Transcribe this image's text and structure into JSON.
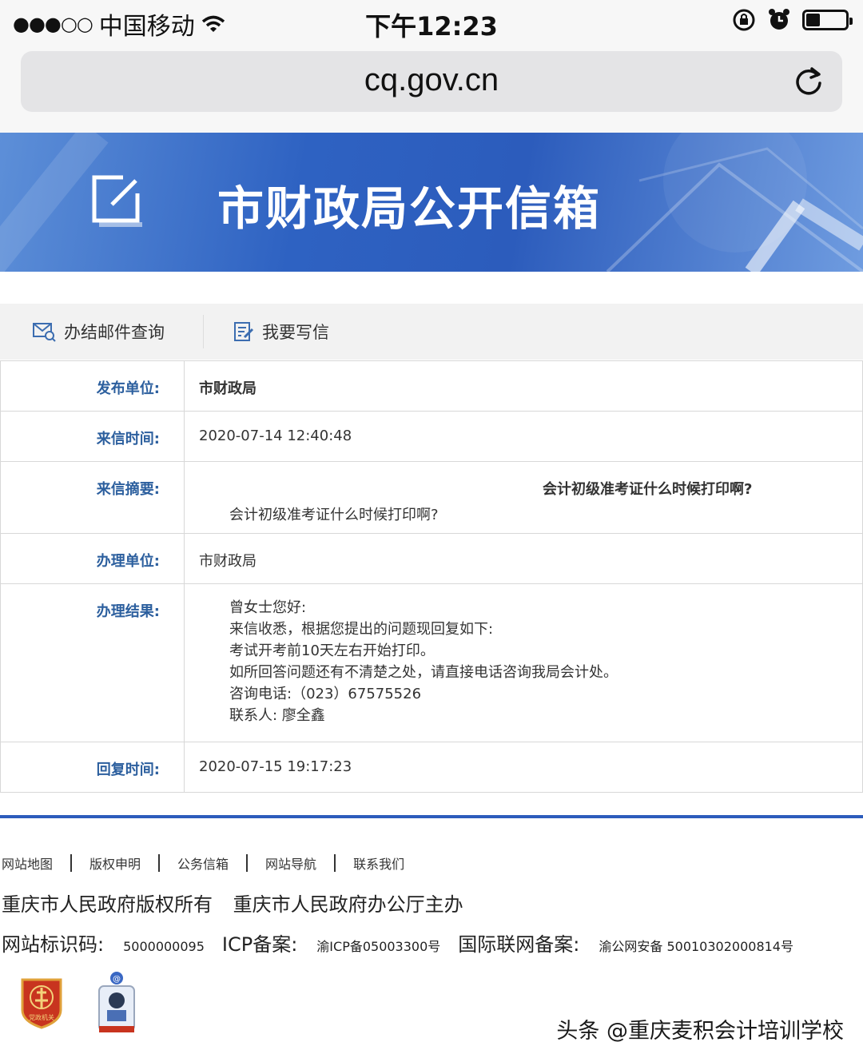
{
  "status_bar": {
    "signal": "●●●○○",
    "carrier": "中国移动",
    "time": "下午12:23",
    "battery_level": 0.35
  },
  "url_bar": {
    "url": "cq.gov.cn"
  },
  "banner": {
    "title": "市财政局公开信箱"
  },
  "tabs": [
    {
      "label": "办结邮件查询",
      "icon": "mail-search-icon"
    },
    {
      "label": "我要写信",
      "icon": "write-letter-icon"
    }
  ],
  "details": {
    "publisher_label": "发布单位:",
    "publisher_value": "市财政局",
    "received_label": "来信时间:",
    "received_value": "2020-07-14 12:40:48",
    "summary_label": "来信摘要:",
    "summary_title": "会计初级准考证什么时候打印啊?",
    "summary_body": "会计初级准考证什么时候打印啊?",
    "handler_label": "办理单位:",
    "handler_value": "市财政局",
    "result_label": "办理结果:",
    "result_lines": [
      "曾女士您好:",
      "来信收悉，根据您提出的问题现回复如下:",
      "考试开考前10天左右开始打印。",
      "如所回答问题还有不清楚之处，请直接电话咨询我局会计处。",
      "咨询电话:（023）67575526",
      "联系人: 廖全鑫"
    ],
    "reply_label": "回复时间:",
    "reply_value": "2020-07-15 19:17:23"
  },
  "footer": {
    "links": [
      "网站地图",
      "版权申明",
      "公务信箱",
      "网站导航",
      "联系我们"
    ],
    "copyright": "重庆市人民政府版权所有",
    "host": "重庆市人民政府办公厅主办",
    "site_id_label": "网站标识码:",
    "site_id_value": "5000000095",
    "icp_label": "ICP备案:",
    "icp_value": "渝ICP备05003300号",
    "net_label": "国际联网备案:",
    "net_value": "渝公网安备 50010302000814号",
    "badge_text": "党政机关"
  },
  "watermark": "头条 @重庆麦积会计培训学校",
  "colors": {
    "accent": "#2c5cbc",
    "label": "#2c5f9e"
  }
}
